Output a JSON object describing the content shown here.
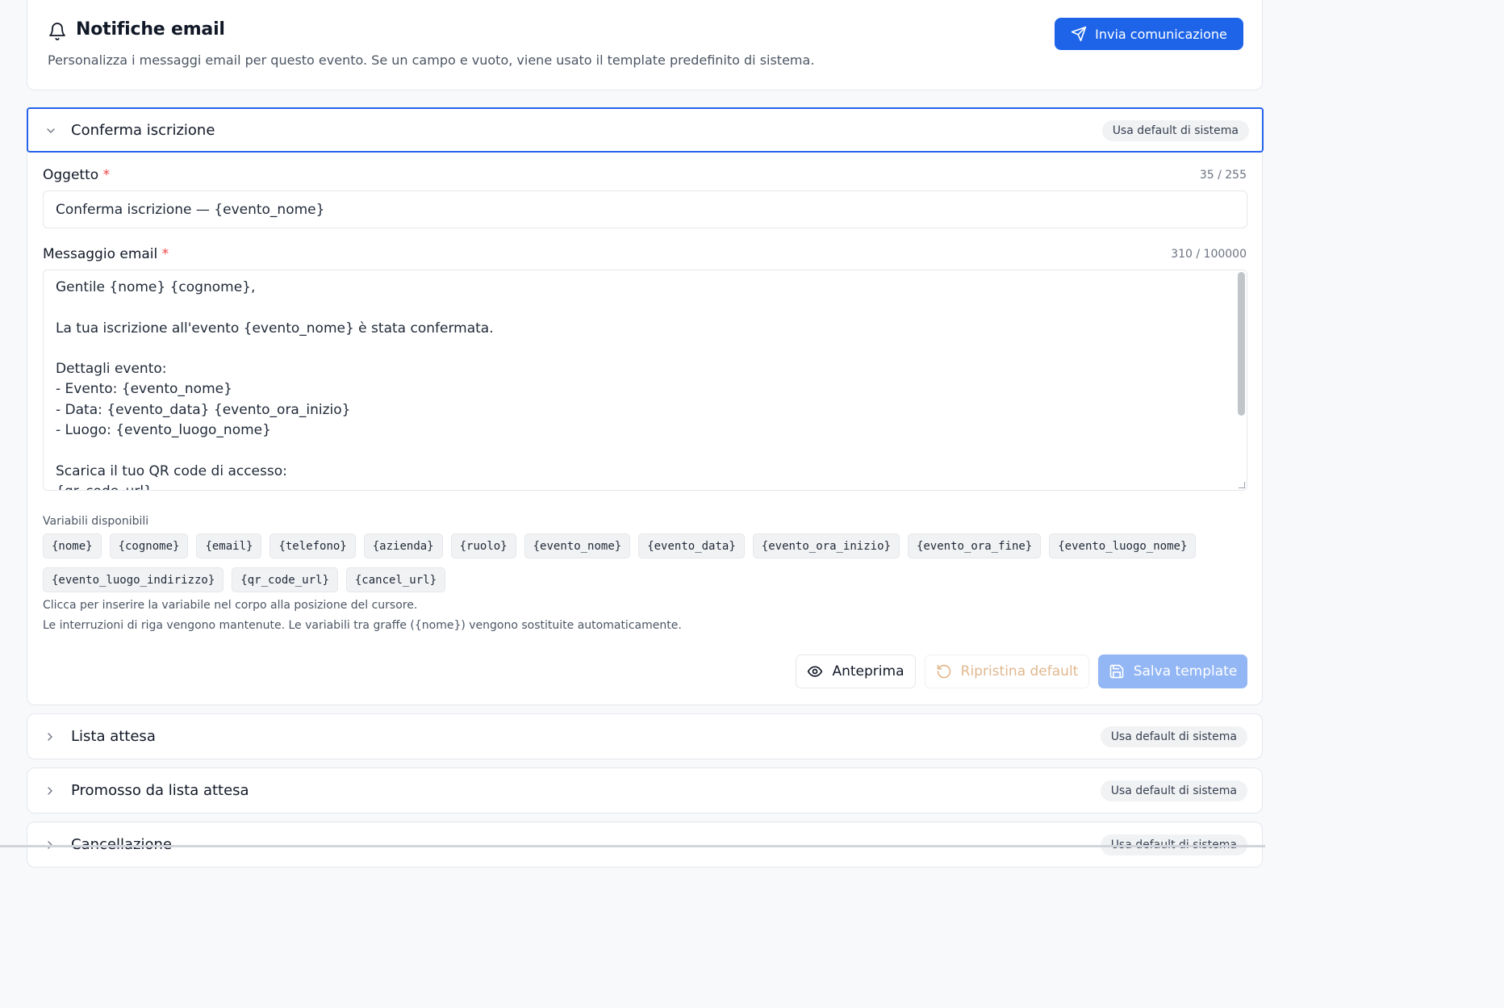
{
  "header": {
    "title": "Notifiche email",
    "subtitle": "Personalizza i messaggi email per questo evento. Se un campo e vuoto, viene usato il template predefinito di sistema.",
    "send_button": "Invia comunicazione"
  },
  "sections": [
    {
      "title": "Conferma iscrizione",
      "badge": "Usa default di sistema",
      "expanded": true,
      "subject_label": "Oggetto",
      "required_mark": "*",
      "subject_counter": "35 / 255",
      "subject_value": "Conferma iscrizione — {evento_nome}",
      "message_label": "Messaggio email",
      "message_counter": "310 / 100000",
      "message_value": "Gentile {nome} {cognome},\n\nLa tua iscrizione all'evento {evento_nome} è stata confermata.\n\nDettagli evento:\n- Evento: {evento_nome}\n- Data: {evento_data} {evento_ora_inizio}\n- Luogo: {evento_luogo_nome}\n\nScarica il tuo QR code di accesso:\n{qr_code_url}",
      "variables_label": "Variabili disponibili",
      "variables": [
        "{nome}",
        "{cognome}",
        "{email}",
        "{telefono}",
        "{azienda}",
        "{ruolo}",
        "{evento_nome}",
        "{evento_data}",
        "{evento_ora_inizio}",
        "{evento_ora_fine}",
        "{evento_luogo_nome}",
        "{evento_luogo_indirizzo}",
        "{qr_code_url}",
        "{cancel_url}"
      ],
      "hint_1": "Clicca per inserire la variabile nel corpo alla posizione del cursore.",
      "hint_2": "Le interruzioni di riga vengono mantenute. Le variabili tra graffe ({nome}) vengono sostituite automaticamente.",
      "preview_button": "Anteprima",
      "reset_button": "Ripristina default",
      "save_button": "Salva template"
    },
    {
      "title": "Lista attesa",
      "badge": "Usa default di sistema",
      "expanded": false
    },
    {
      "title": "Promosso da lista attesa",
      "badge": "Usa default di sistema",
      "expanded": false
    },
    {
      "title": "Cancellazione",
      "badge": "Usa default di sistema",
      "expanded": false
    }
  ],
  "colors": {
    "primary": "#1d64e8",
    "focus_border": "#2563eb",
    "required": "#ef4444",
    "save_disabled": "#93b6f5",
    "reset_disabled_text": "#e0b88f"
  },
  "icons": [
    "bell-icon",
    "send-icon",
    "chevron-down-icon",
    "chevron-right-icon",
    "eye-icon",
    "rotate-ccw-icon",
    "save-icon"
  ]
}
